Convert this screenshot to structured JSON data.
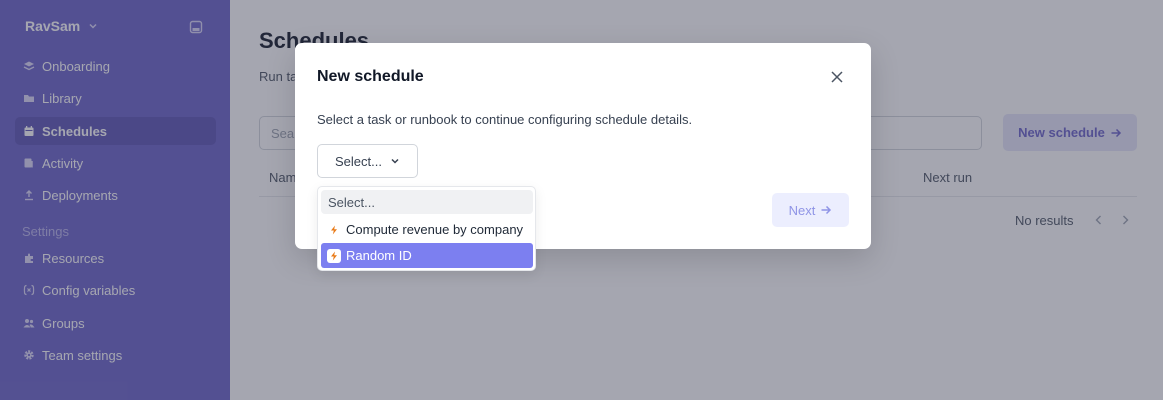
{
  "sidebar": {
    "workspace": "RavSam",
    "items": [
      {
        "label": "Onboarding",
        "icon": "onboarding-icon"
      },
      {
        "label": "Library",
        "icon": "folder-icon"
      },
      {
        "label": "Schedules",
        "icon": "calendar-icon"
      },
      {
        "label": "Activity",
        "icon": "activity-icon"
      },
      {
        "label": "Deployments",
        "icon": "upload-icon"
      }
    ],
    "settings_label": "Settings",
    "settings_items": [
      {
        "label": "Resources",
        "icon": "puzzle-icon"
      },
      {
        "label": "Config variables",
        "icon": "variable-icon"
      },
      {
        "label": "Groups",
        "icon": "users-icon"
      },
      {
        "label": "Team settings",
        "icon": "gear-icon"
      }
    ]
  },
  "page": {
    "title": "Schedules",
    "subtitle": "Run ta",
    "search_placeholder": "Sear",
    "new_schedule_label": "New schedule",
    "columns": [
      "Nam",
      "Next run"
    ],
    "no_results": "No results"
  },
  "modal": {
    "title": "New schedule",
    "description": "Select a task or runbook to continue configuring schedule details.",
    "select_label": "Select...",
    "next_label": "Next"
  },
  "dropdown": {
    "search_placeholder": "Select...",
    "options": [
      {
        "label": "Compute revenue by company",
        "icon": "lightning-icon",
        "highlighted": false
      },
      {
        "label": "Random ID",
        "icon": "lightning-icon",
        "highlighted": true
      }
    ]
  },
  "colors": {
    "sidebar": "#6b63c9",
    "accent": "#7c7ff0",
    "bolt": "#e97a17"
  }
}
